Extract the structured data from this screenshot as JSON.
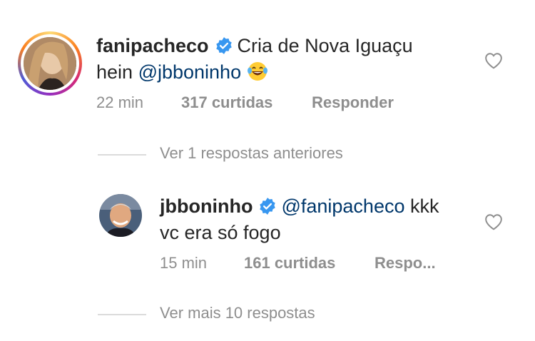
{
  "comments": [
    {
      "username": "fanipacheco",
      "text_before": "Cria de Nova Iguaçu",
      "text_line2_prefix": "hein ",
      "mention": "@jbboninho",
      "emoji": "laughing-tears-emoji",
      "time": "22 min",
      "likes": "317 curtidas",
      "reply": "Responder"
    },
    {
      "username": "jbboninho",
      "mention": "@fanipacheco",
      "text_after": " kkk",
      "text_line2": "vc era só fogo",
      "time": "15 min",
      "likes": "161 curtidas",
      "reply": "Respo..."
    }
  ],
  "view_previous": "Ver 1 respostas anteriores",
  "view_more": "Ver mais 10 respostas",
  "colors": {
    "text": "#262626",
    "muted": "#8e8e8e",
    "mention": "#00376b",
    "verified": "#3897f0",
    "divider": "#dbdbdb"
  }
}
